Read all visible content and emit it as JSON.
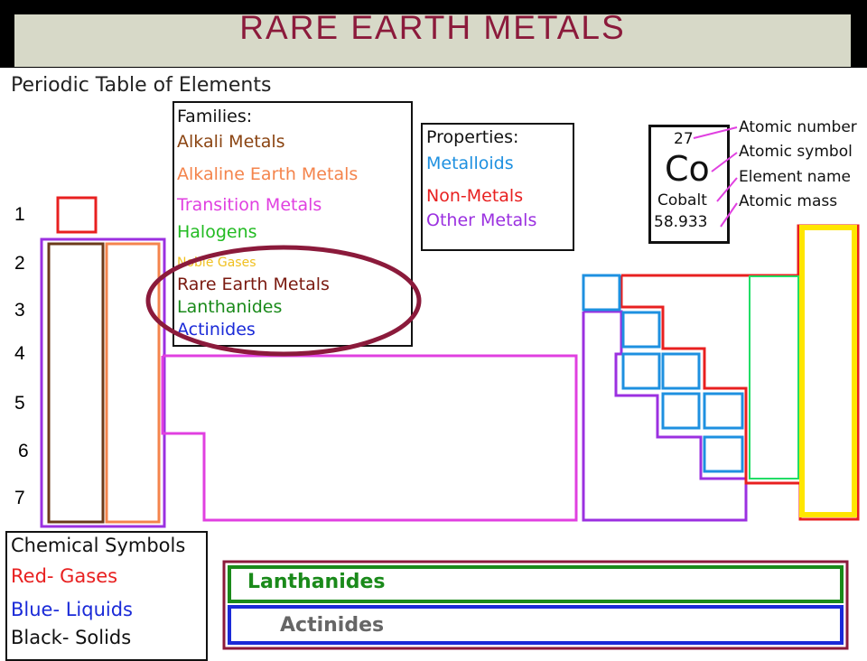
{
  "slide": {
    "title": "RARE EARTH METALS",
    "subtitle": "Periodic Table of Elements"
  },
  "families": {
    "heading": "Families:",
    "items": [
      {
        "label": "Alkali Metals",
        "color": "#8b4513"
      },
      {
        "label": "Alkaline Earth Metals",
        "color": "#f4844c"
      },
      {
        "label": "Transition Metals",
        "color": "#e040e0"
      },
      {
        "label": "Halogens",
        "color": "#22bb22"
      },
      {
        "label": "Noble Gases",
        "color": "#f0c020"
      },
      {
        "label": "Rare Earth Metals",
        "color": "#7a1a10"
      },
      {
        "label": "Lanthanides",
        "color": "#1a8a1a"
      },
      {
        "label": "Actinides",
        "color": "#1a2ad8"
      }
    ]
  },
  "properties": {
    "heading": "Properties:",
    "items": [
      {
        "label": "Metalloids",
        "color": "#1e90e0"
      },
      {
        "label": "Non-Metals",
        "color": "#e82020"
      },
      {
        "label": "Other Metals",
        "color": "#9b30e0"
      }
    ]
  },
  "element_key": {
    "number": "27",
    "symbol": "Co",
    "name": "Cobalt",
    "mass": "58.933",
    "labels": [
      "Atomic number",
      "Atomic symbol",
      "Element name",
      "Atomic mass"
    ]
  },
  "periods": [
    "1",
    "2",
    "3",
    "4",
    "5",
    "6",
    "7"
  ],
  "chemical_symbols": {
    "heading": "Chemical Symbols",
    "items": [
      {
        "label": "Red- Gases",
        "color": "#e82020"
      },
      {
        "label": "Blue- Liquids",
        "color": "#1a2ad8"
      },
      {
        "label": "Black- Solids",
        "color": "#111111"
      }
    ]
  },
  "bands": {
    "lanthanides": "Lanthanides",
    "actinides": "Actinides"
  }
}
